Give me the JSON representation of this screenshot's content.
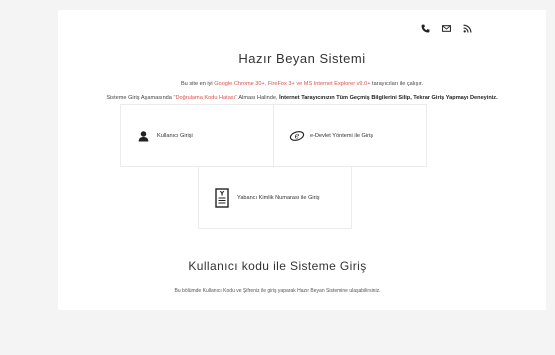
{
  "top_icons": [
    "phone-icon",
    "mail-icon",
    "rss-icon"
  ],
  "page_title": "Hazır Beyan Sistemi",
  "browser_notice": {
    "prefix": "Bu site en iyi ",
    "browsers": "Google Chrome 30+, FireFox 3+ ve MS Internet Explorer v9.0+",
    "suffix": " tarayıcıları ile çalışır."
  },
  "error_notice": {
    "prefix": "Sisteme Giriş Aşamasında ",
    "error_name": "\"Doğrulama Kodu Hatası\"",
    "middle": " Alması Halinde, ",
    "bold": "İnternet Tarayıcınızın Tüm Geçmiş Bilgilerini Silip, Tekrar Giriş Yapmayı Deneyiniz."
  },
  "login_options": {
    "user_login": "Kullanıcı Girişi",
    "edevlet_login": "e-Devlet Yöntemi ile Giriş",
    "foreign_id_login": "Yabancı Kimlik Numarası ile Giriş"
  },
  "section_heading": "Kullanıcı kodu ile Sisteme Giriş",
  "section_description": "Bu bölümde Kullanıcı Kodu ve Şifreniz ile giriş yaparak Hazır Beyan Sistemine ulaşabilirsiniz.",
  "colors": {
    "accent_red": "#d9534f",
    "background": "#f4f4f4",
    "card": "#ffffff"
  }
}
